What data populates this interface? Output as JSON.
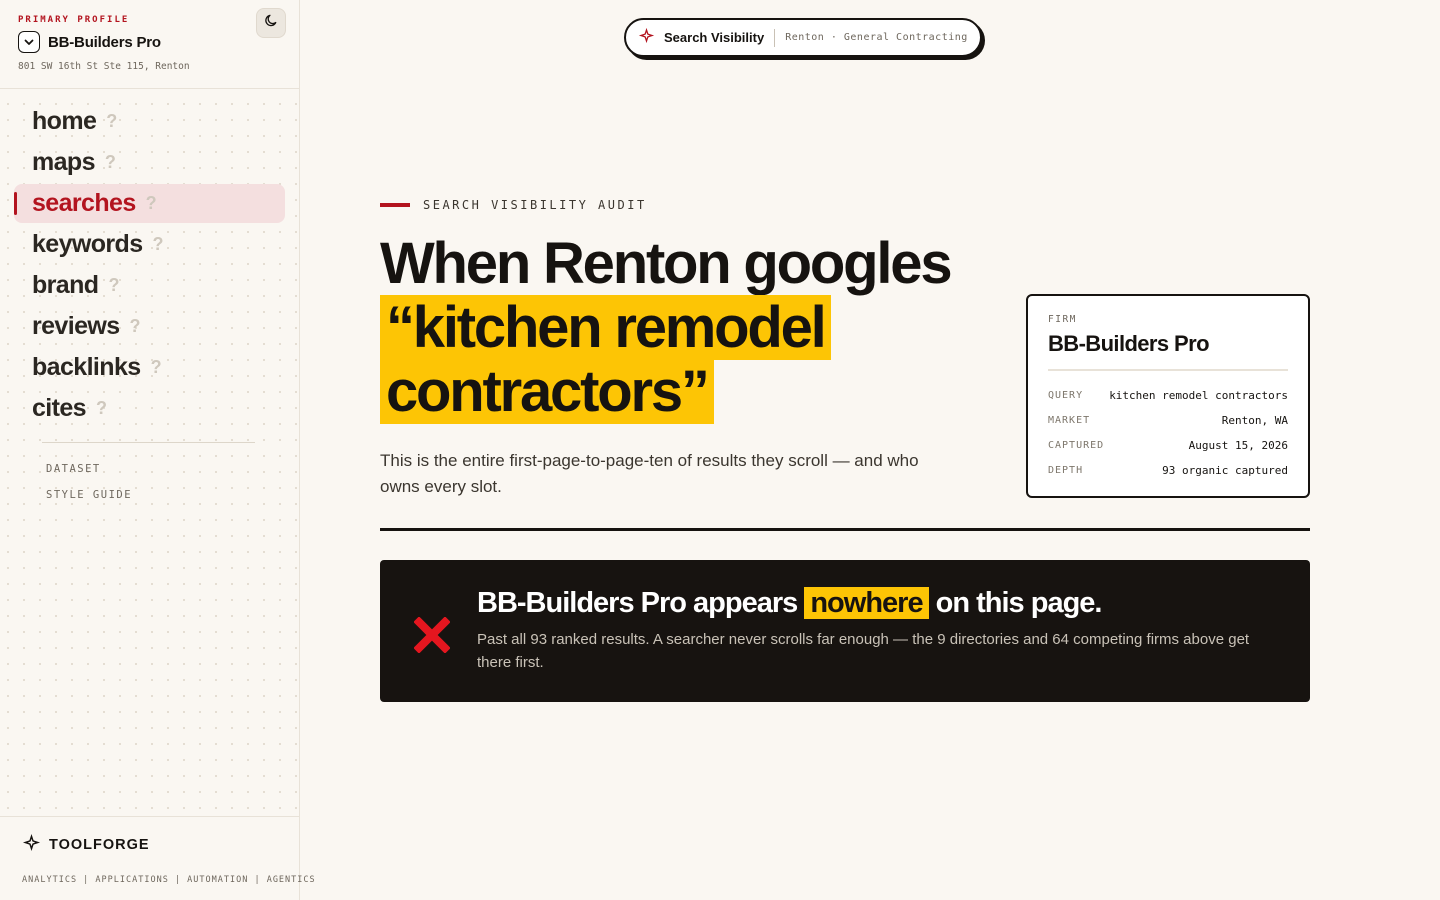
{
  "profile": {
    "label": "PRIMARY PROFILE",
    "name": "BB-Builders Pro",
    "address": "801 SW 16th St Ste 115, Renton"
  },
  "nav": {
    "items": [
      {
        "label": "home",
        "hint": "?",
        "active": false
      },
      {
        "label": "maps",
        "hint": "?",
        "active": false
      },
      {
        "label": "searches",
        "hint": "?",
        "active": true
      },
      {
        "label": "keywords",
        "hint": "?",
        "active": false
      },
      {
        "label": "brand",
        "hint": "?",
        "active": false
      },
      {
        "label": "reviews",
        "hint": "?",
        "active": false
      },
      {
        "label": "backlinks",
        "hint": "?",
        "active": false
      },
      {
        "label": "cites",
        "hint": "?",
        "active": false
      }
    ],
    "secondary": [
      "DATASET",
      "STYLE GUIDE"
    ]
  },
  "brand": {
    "name": "TOOLFORGE",
    "tagline": "ANALYTICS | APPLICATIONS | AUTOMATION | AGENTICS"
  },
  "pill": {
    "title": "Search Visibility",
    "subtitle": "Renton · General Contracting"
  },
  "main": {
    "eyebrow": "SEARCH VISIBILITY AUDIT",
    "headline_prefix": "When Renton googles",
    "headline_query": "“kitchen remodel contractors”",
    "lede": "This is the entire first-page-to-page-ten of results they scroll — and who owns every slot."
  },
  "firm_card": {
    "label": "FIRM",
    "name": "BB-Builders Pro",
    "rows": [
      {
        "key": "QUERY",
        "value": "kitchen remodel contractors"
      },
      {
        "key": "MARKET",
        "value": "Renton, WA"
      },
      {
        "key": "CAPTURED",
        "value": "August 15, 2026"
      },
      {
        "key": "DEPTH",
        "value": "93 organic captured"
      }
    ]
  },
  "alert": {
    "title_prefix": "BB-Builders Pro appears",
    "title_highlight": "nowhere",
    "title_suffix": "on this page.",
    "body": "Past all 93 ranked results. A searcher never scrolls far enough — the 9 directories and 64 competing firms above get there first."
  },
  "colors": {
    "accent_red": "#b3141f",
    "highlight_yellow": "#fdc505",
    "ink": "#161310",
    "paper": "#faf7f2",
    "alert_x_red": "#e5161f"
  }
}
